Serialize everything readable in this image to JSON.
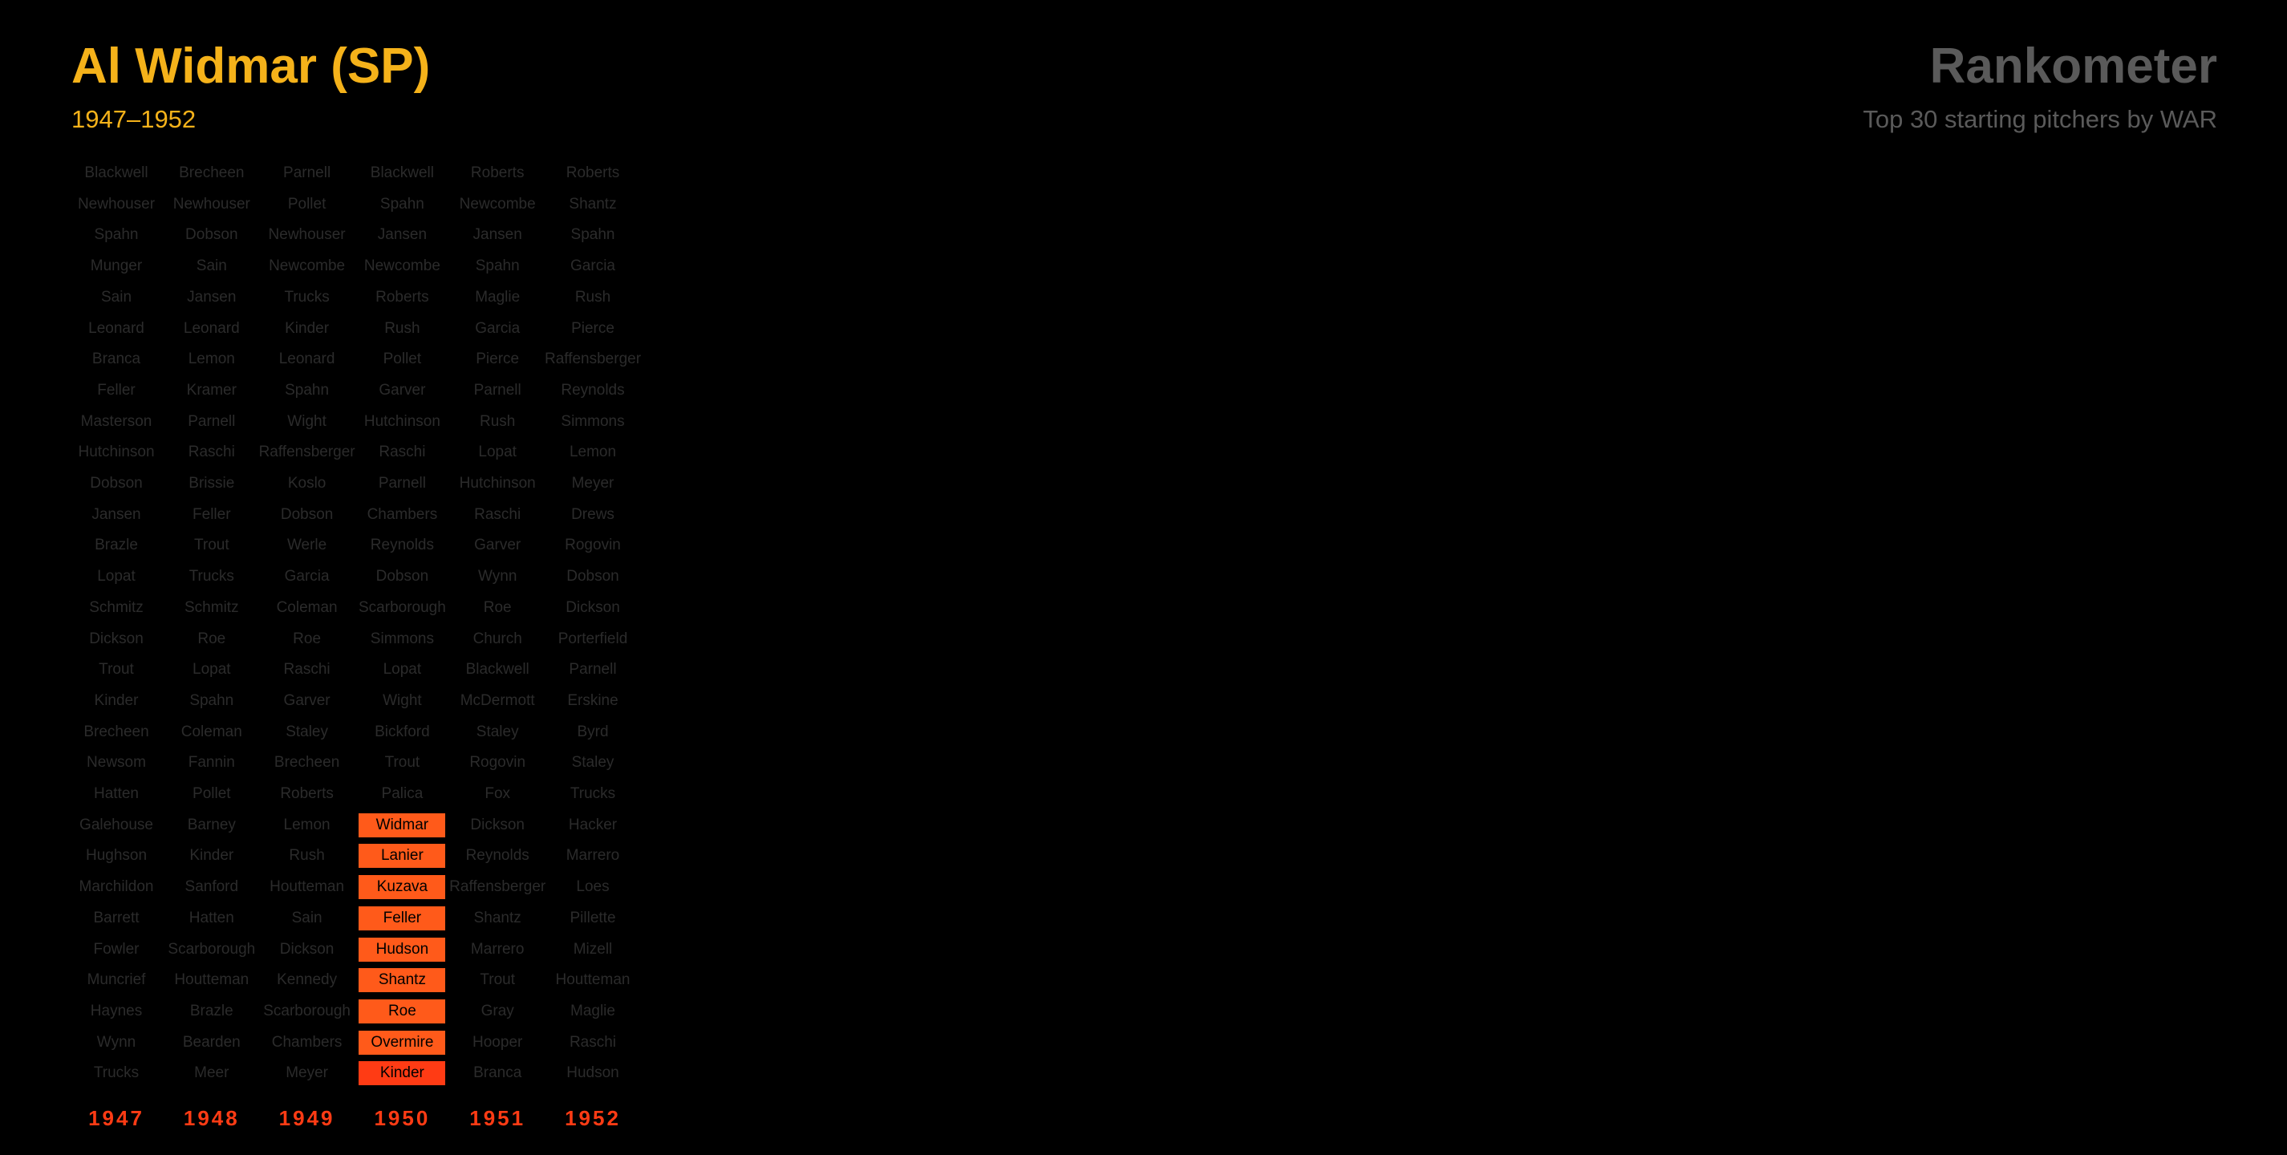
{
  "header": {
    "player": "Al Widmar (SP)",
    "years": "1947–1952",
    "brand": "Rankometer",
    "subtitle": "Top 30 starting pitchers by WAR"
  },
  "colors": {
    "accent": "#f5b21a",
    "highlight": "#ff5a1a",
    "year_label": "#ff3b14",
    "dim_text": "#2b2b2b",
    "brand": "#5a5a5a",
    "background": "#000000"
  },
  "chart_data": {
    "type": "table",
    "title": "Al Widmar (SP)",
    "highlighted_player": "Widmar",
    "highlighted_year": "1950",
    "highlighted_ranks": [
      22,
      23,
      24,
      25,
      26,
      27,
      28,
      29,
      30
    ],
    "years": [
      "1947",
      "1948",
      "1949",
      "1950",
      "1951",
      "1952"
    ],
    "columns": [
      [
        "Blackwell",
        "Newhouser",
        "Spahn",
        "Munger",
        "Sain",
        "Leonard",
        "Branca",
        "Feller",
        "Masterson",
        "Hutchinson",
        "Dobson",
        "Jansen",
        "Brazle",
        "Lopat",
        "Schmitz",
        "Dickson",
        "Trout",
        "Kinder",
        "Brecheen",
        "Newsom",
        "Hatten",
        "Galehouse",
        "Hughson",
        "Marchildon",
        "Barrett",
        "Fowler",
        "Muncrief",
        "Haynes",
        "Wynn",
        "Trucks"
      ],
      [
        "Brecheen",
        "Newhouser",
        "Dobson",
        "Sain",
        "Jansen",
        "Leonard",
        "Lemon",
        "Kramer",
        "Parnell",
        "Raschi",
        "Brissie",
        "Feller",
        "Trout",
        "Trucks",
        "Schmitz",
        "Roe",
        "Lopat",
        "Spahn",
        "Coleman",
        "Fannin",
        "Pollet",
        "Barney",
        "Kinder",
        "Sanford",
        "Hatten",
        "Scarborough",
        "Houtteman",
        "Brazle",
        "Bearden",
        "Meer"
      ],
      [
        "Parnell",
        "Pollet",
        "Newhouser",
        "Newcombe",
        "Trucks",
        "Kinder",
        "Leonard",
        "Spahn",
        "Wight",
        "Raffensberger",
        "Koslo",
        "Dobson",
        "Werle",
        "Garcia",
        "Coleman",
        "Roe",
        "Raschi",
        "Garver",
        "Staley",
        "Brecheen",
        "Roberts",
        "Lemon",
        "Rush",
        "Houtteman",
        "Sain",
        "Dickson",
        "Kennedy",
        "Scarborough",
        "Chambers",
        "Meyer"
      ],
      [
        "Blackwell",
        "Spahn",
        "Jansen",
        "Newcombe",
        "Roberts",
        "Rush",
        "Pollet",
        "Garver",
        "Hutchinson",
        "Raschi",
        "Parnell",
        "Chambers",
        "Reynolds",
        "Dobson",
        "Scarborough",
        "Simmons",
        "Lopat",
        "Wight",
        "Bickford",
        "Trout",
        "Palica",
        "Widmar",
        "Lanier",
        "Kuzava",
        "Feller",
        "Hudson",
        "Shantz",
        "Roe",
        "Overmire",
        "Kinder"
      ],
      [
        "Roberts",
        "Newcombe",
        "Jansen",
        "Spahn",
        "Maglie",
        "Garcia",
        "Pierce",
        "Parnell",
        "Rush",
        "Lopat",
        "Hutchinson",
        "Raschi",
        "Garver",
        "Wynn",
        "Roe",
        "Church",
        "Blackwell",
        "McDermott",
        "Staley",
        "Rogovin",
        "Fox",
        "Dickson",
        "Reynolds",
        "Raffensberger",
        "Shantz",
        "Marrero",
        "Trout",
        "Gray",
        "Hooper",
        "Branca"
      ],
      [
        "Roberts",
        "Shantz",
        "Spahn",
        "Garcia",
        "Rush",
        "Pierce",
        "Raffensberger",
        "Reynolds",
        "Simmons",
        "Lemon",
        "Meyer",
        "Drews",
        "Rogovin",
        "Dobson",
        "Dickson",
        "Porterfield",
        "Parnell",
        "Erskine",
        "Byrd",
        "Staley",
        "Trucks",
        "Hacker",
        "Marrero",
        "Loes",
        "Pillette",
        "Mizell",
        "Houtteman",
        "Maglie",
        "Raschi",
        "Hudson"
      ]
    ]
  }
}
